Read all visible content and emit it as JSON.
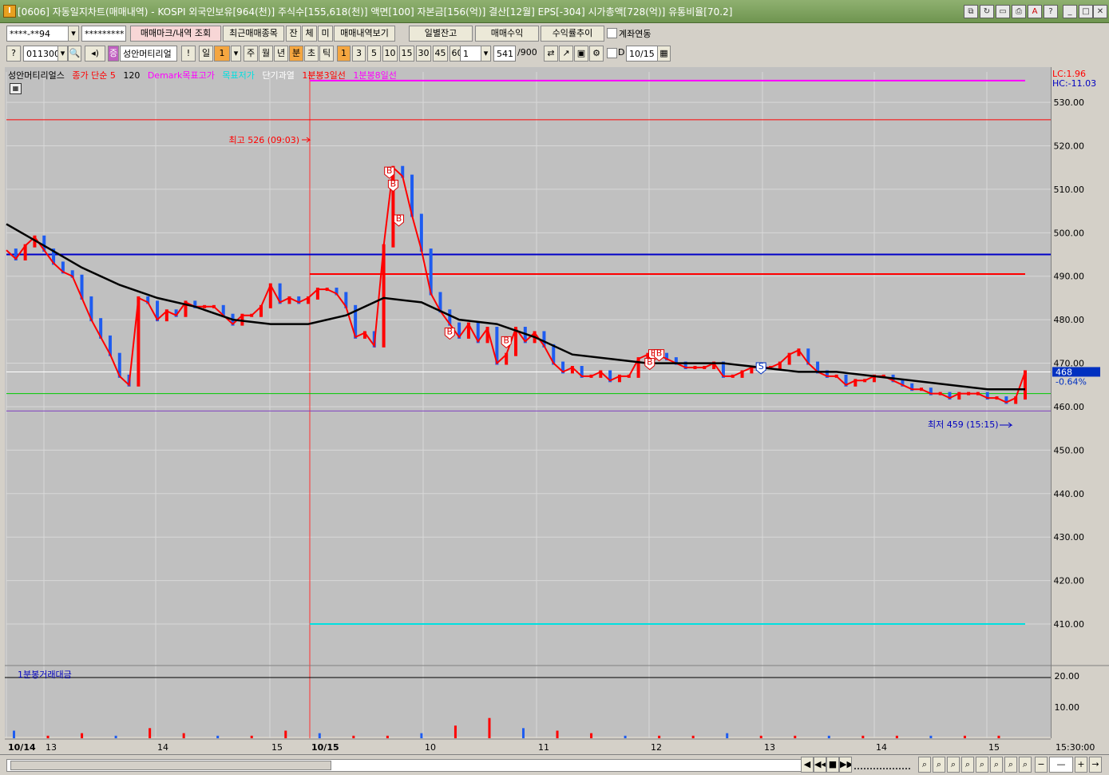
{
  "window": {
    "title": "[0606] 자동일지차트(매매내역) - KOSPI 외국인보유[964(천)] 주식수[155,618(천)] 액면[100] 자본금[156(억)] 결산[12월] EPS[-304] 시가총액[728(억)] 유통비율[70.2]",
    "app_icon": "I"
  },
  "toolbar1": {
    "account": "****-**94",
    "password": "*********",
    "mark_btn": "매매마크/내역 조회",
    "recent_btn": "최근매매종목",
    "jan": "잔",
    "che": "체",
    "mi": "미",
    "history_btn": "매매내역보기",
    "daily_btn": "일별잔고",
    "profit_btn": "매매수익",
    "trend_btn": "수익률추이",
    "link_label": "계좌연동"
  },
  "toolbar2": {
    "code": "011300",
    "name": "성안머티리얼",
    "excl": "!",
    "periods": [
      "일",
      "1",
      "주",
      "월",
      "년",
      "분",
      "초",
      "틱"
    ],
    "intervals": [
      "1",
      "3",
      "5",
      "10",
      "15",
      "30",
      "45",
      "60"
    ],
    "count": "1",
    "bars": "541",
    "bars_total": "/900",
    "d_label": "D",
    "date": "10/15"
  },
  "legend": {
    "stock": "성안머티리얼스",
    "ma": "종가 단순 5",
    "ma_val": "120",
    "demark_hi": "Demark목표고가",
    "demark_lo": "목표저가",
    "short": "단기과열",
    "line3": "1분봉3일선",
    "line8": "1분봉8일선"
  },
  "volume_legend": "1분봉거래대금",
  "colors": {
    "up": "#ff0000",
    "down": "#1e5cf0",
    "ma": "#000000",
    "demark_hi": "#ff00ff",
    "demark_lo": "#00e0e0",
    "hline_blue": "#0000c8",
    "hline_red": "#ff0000",
    "hline_green": "#00cc00",
    "hline_purple": "#8040c0"
  },
  "chart_data": {
    "type": "line",
    "title": "",
    "ylim": [
      401,
      537
    ],
    "yticks": [
      "530.00",
      "520.00",
      "510.00",
      "500.00",
      "490.00",
      "480.00",
      "470.00",
      "460.00",
      "450.00",
      "440.00",
      "430.00",
      "420.00",
      "410.00"
    ],
    "xticks": [
      "10/14",
      "13",
      "14",
      "15",
      "10/15",
      "10",
      "11",
      "12",
      "13",
      "14",
      "15"
    ],
    "current_price": "468",
    "change_pct": "-0.64%",
    "lc": "LC:1.96",
    "hc": "HC:-11.03",
    "time_label": "15:30:00",
    "high_label": "최고 526 (09:03)",
    "low_label": "최저 459 (15:15)",
    "hlines": [
      {
        "name": "demark_hi",
        "value": 535
      },
      {
        "name": "high",
        "value": 526
      },
      {
        "name": "blue",
        "value": 495
      },
      {
        "name": "red",
        "value": 490.5
      },
      {
        "name": "green",
        "value": 463
      },
      {
        "name": "purple",
        "value": 459
      },
      {
        "name": "demark_lo",
        "value": 410
      }
    ],
    "series": [
      {
        "name": "price",
        "x": [
          0,
          5,
          10,
          15,
          20,
          25,
          30,
          35,
          40,
          45,
          50,
          55,
          60,
          65,
          70,
          75,
          80,
          85,
          90,
          95,
          100,
          105,
          110,
          115,
          120,
          125,
          130,
          135,
          140,
          145,
          150,
          155,
          160,
          165,
          170,
          175,
          180,
          185,
          190,
          195,
          200,
          205,
          210,
          215,
          220,
          225,
          230,
          235,
          240,
          245,
          250,
          255,
          260,
          265,
          270,
          275,
          280,
          285,
          290,
          295,
          300,
          305,
          310,
          315,
          320,
          325,
          330,
          335,
          340,
          345,
          350,
          355,
          360,
          365,
          370,
          375,
          380,
          385,
          390,
          395,
          400,
          405,
          410,
          415,
          420,
          425,
          430,
          435,
          440,
          445,
          450,
          455,
          460,
          465,
          470,
          475,
          480,
          485,
          490,
          495,
          500,
          505,
          510,
          515,
          520,
          525,
          530,
          535,
          540
        ],
        "values": [
          496,
          494,
          497,
          499,
          496,
          493,
          491,
          490,
          485,
          480,
          476,
          472,
          467,
          465,
          485,
          484,
          480,
          482,
          481,
          484,
          483,
          483,
          483,
          481,
          479,
          481,
          481,
          483,
          488,
          484,
          485,
          484,
          485,
          487,
          487,
          486,
          483,
          476,
          477,
          474,
          497,
          515,
          513,
          504,
          496,
          486,
          482,
          479,
          476,
          479,
          475,
          478,
          470,
          472,
          478,
          475,
          477,
          474,
          470,
          468,
          469,
          467,
          467,
          468,
          466,
          467,
          467,
          471,
          472,
          472,
          471,
          470,
          469,
          469,
          469,
          470,
          467,
          467,
          468,
          469,
          469,
          469,
          470,
          472,
          473,
          470,
          468,
          467,
          467,
          465,
          466,
          466,
          467,
          467,
          466,
          465,
          464,
          464,
          463,
          463,
          462,
          463,
          463,
          463,
          462,
          462,
          461,
          462,
          468
        ]
      },
      {
        "name": "ma",
        "x": [
          0,
          20,
          40,
          60,
          80,
          100,
          120,
          140,
          160,
          180,
          200,
          220,
          240,
          260,
          280,
          300,
          320,
          340,
          360,
          380,
          400,
          420,
          440,
          460,
          480,
          500,
          520,
          540
        ],
        "values": [
          502,
          497,
          492,
          488,
          485,
          483,
          480,
          479,
          479,
          481,
          485,
          484,
          480,
          479,
          476,
          472,
          471,
          470,
          470,
          470,
          469,
          468,
          468,
          467,
          466,
          465,
          464,
          464
        ]
      },
      {
        "name": "volume",
        "values": [
          3,
          1,
          2,
          1,
          4,
          2,
          1,
          1,
          3,
          2,
          1,
          1,
          2,
          5,
          8,
          4,
          3,
          2,
          1,
          1,
          1,
          2,
          1,
          1,
          1,
          1,
          1,
          1,
          1,
          1
        ]
      }
    ],
    "volume_ylim": [
      0,
      24
    ],
    "volume_ticks": [
      "20.00",
      "10.00"
    ],
    "markers": [
      {
        "type": "B",
        "x": 203,
        "y": 514
      },
      {
        "type": "B",
        "x": 205,
        "y": 511
      },
      {
        "type": "B",
        "x": 208,
        "y": 503
      },
      {
        "type": "B",
        "x": 235,
        "y": 477
      },
      {
        "type": "B",
        "x": 265,
        "y": 475
      },
      {
        "type": "B",
        "x": 343,
        "y": 472
      },
      {
        "type": "B",
        "x": 346,
        "y": 472
      },
      {
        "type": "B",
        "x": 341,
        "y": 470
      },
      {
        "type": "S",
        "x": 400,
        "y": 469
      }
    ]
  },
  "statusbar": {
    "nav": [
      "◀",
      "◀◀",
      "■",
      "▶▶"
    ],
    "zoom": [
      "−",
      "+",
      "→"
    ]
  }
}
